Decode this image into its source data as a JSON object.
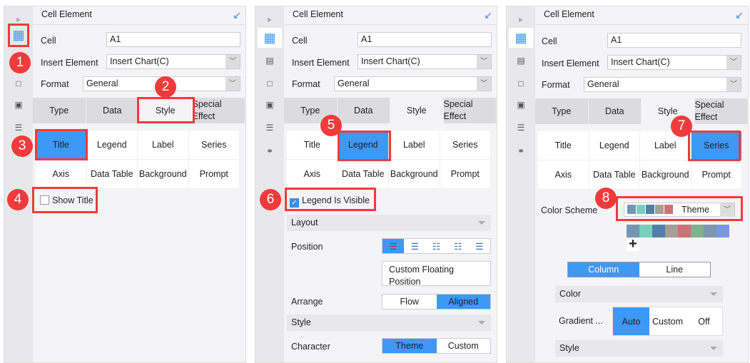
{
  "panel": {
    "title": "Cell Element",
    "cell_label": "Cell",
    "cell_value": "A1",
    "insert_label": "Insert Element",
    "insert_value": "Insert Chart(C)",
    "format_label": "Format",
    "format_value": "General"
  },
  "tabs": [
    "Type",
    "Data",
    "Style",
    "Special Effect"
  ],
  "subtabs": [
    "Title",
    "Legend",
    "Label",
    "Series",
    "Axis",
    "Data Table",
    "Background",
    "Prompt"
  ],
  "badges": [
    "1",
    "2",
    "3",
    "4",
    "5",
    "6",
    "7",
    "8"
  ],
  "p1": {
    "show_title": "Show Title"
  },
  "p2": {
    "legend_visible": "Legend Is Visible",
    "layout": "Layout",
    "position": "Position",
    "custom_floating": "Custom Floating Position",
    "arrange": "Arrange",
    "flow": "Flow",
    "aligned": "Aligned",
    "style": "Style",
    "character": "Character",
    "theme": "Theme",
    "custom": "Custom"
  },
  "p3": {
    "color_scheme": "Color Scheme",
    "scheme_value": "Theme",
    "column": "Column",
    "line": "Line",
    "color": "Color",
    "gradient": "Gradient ...",
    "auto": "Auto",
    "custom": "Custom",
    "off": "Off",
    "style": "Style"
  },
  "colors": {
    "accent": "#3e98f5",
    "callout": "#ef3b3b",
    "swatches": [
      "#7397b3",
      "#76d0be",
      "#517fa6",
      "#a39e96",
      "#c97373",
      "#80b28e",
      "#7f96b0",
      "#7899e0"
    ]
  }
}
